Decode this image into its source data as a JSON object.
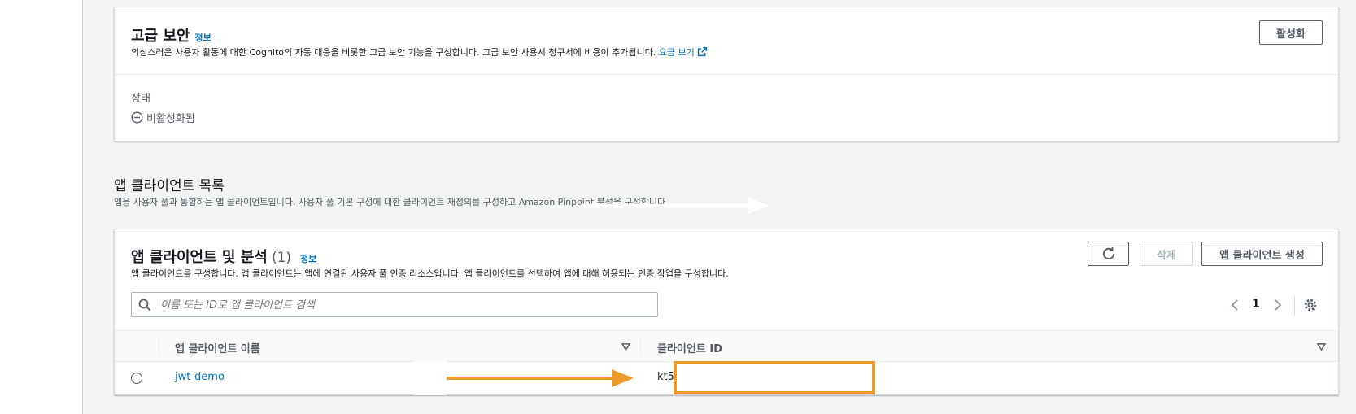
{
  "advanced_security": {
    "title": "고급 보안",
    "info": "정보",
    "description": "의심스러운 사용자 활동에 대한 Cognito의 자동 대응을 비롯한 고급 보안 기능을 구성합니다. 고급 보안 사용시 청구서에 비용이 추가됩니다.",
    "pricing_link": "요금 보기",
    "activate_button": "활성화",
    "status_label": "상태",
    "status_value": "비활성화됨"
  },
  "app_clients_section": {
    "title": "앱 클라이언트 목록",
    "description": "앱을 사용자 풀과 통합하는 앱 클라이언트입니다. 사용자 풀 기본 구성에 대한 클라이언트 재정의를 구성하고 Amazon Pinpoint 분석을 구성합니다."
  },
  "app_clients_table": {
    "title": "앱 클라이언트 및 분석",
    "count": "(1)",
    "info": "정보",
    "description": "앱 클라이언트를 구성합니다. 앱 클라이언트는 앱에 연결된 사용자 풀 인증 리소스입니다. 앱 클라이언트를 선택하여 앱에 대해 허용되는 인증 작업을 구성합니다.",
    "delete_button": "삭제",
    "create_button": "앱 클라이언트 생성",
    "search_placeholder": "이름 또는 ID로 앱 클라이언트 검색",
    "page_number": "1",
    "columns": [
      "앱 클라이언트 이름",
      "클라이언트 ID"
    ],
    "rows": [
      {
        "name": "jwt-demo",
        "client_id": "kt5"
      }
    ]
  },
  "colors": {
    "link": "#0073bb",
    "annotation": "#ec9a29"
  }
}
